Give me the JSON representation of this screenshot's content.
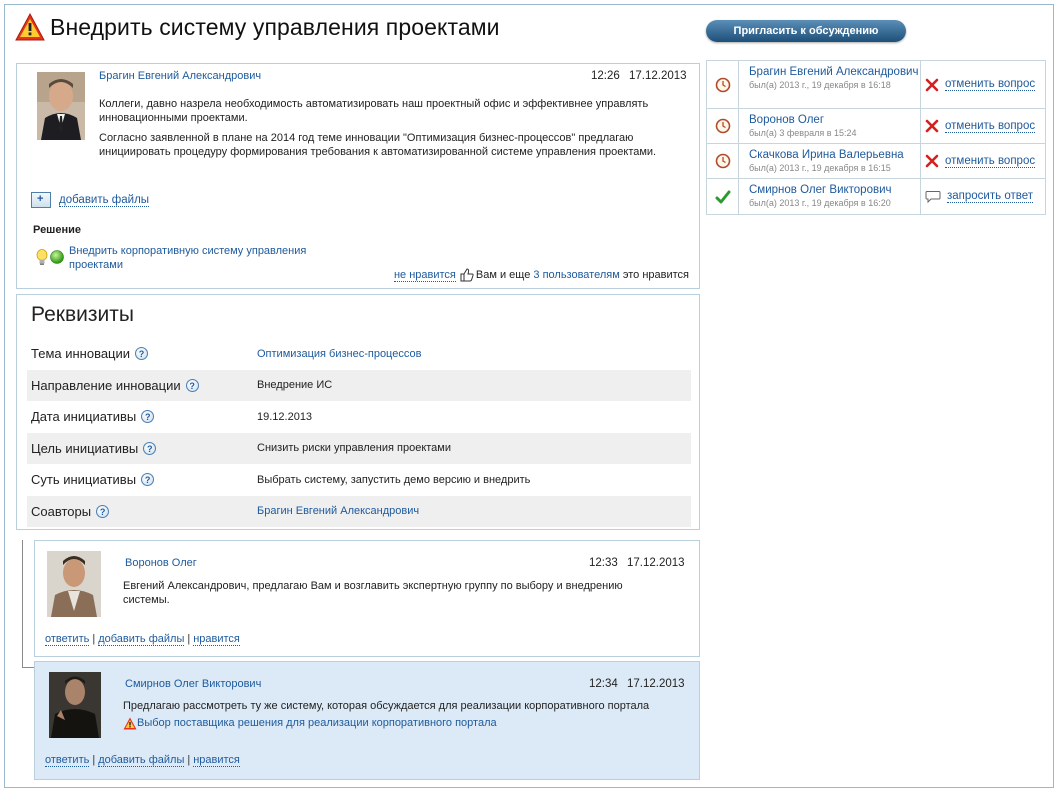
{
  "page": {
    "title": "Внедрить систему управления проектами",
    "invite_button": "Пригласить к обсуждению"
  },
  "post": {
    "author": "Брагин Евгений Александрович",
    "time": "12:26",
    "date": "17.12.2013",
    "paragraphs": [
      "Коллеги, давно назрела необходимость автоматизировать наш проектный офис и эффективнее управлять инновационными проектами.",
      "Согласно заявленной в плане на 2014 год теме инновации \"Оптимизация бизнес-процессов\" предлагаю инициировать процедуру формирования требования к автоматизированной системе управления проектами."
    ],
    "add_files": "добавить файлы",
    "solution_heading": "Решение",
    "solution_link": "Внедрить корпоративную систему управления проектами",
    "dislike": "не нравится",
    "likes_prefix": "Вам и еще",
    "likes_link": "3 пользователям",
    "likes_suffix": "это нравится"
  },
  "requisites": {
    "title": "Реквизиты",
    "rows": [
      {
        "label": "Тема инновации",
        "value": "Оптимизация бизнес-процессов",
        "is_link": true
      },
      {
        "label": "Направление инновации",
        "value": "Внедрение ИС",
        "is_link": false
      },
      {
        "label": "Дата инициативы",
        "value": "19.12.2013",
        "is_link": false
      },
      {
        "label": "Цель инициативы",
        "value": "Снизить риски управления проектами",
        "is_link": false
      },
      {
        "label": "Суть инициативы",
        "value": "Выбрать систему, запустить демо версию и внедрить",
        "is_link": false
      },
      {
        "label": "Соавторы",
        "value": "Брагин Евгений Александрович",
        "is_link": true
      }
    ],
    "help_glyph": "?"
  },
  "comments": [
    {
      "author": "Воронов Олег",
      "time": "12:33",
      "date": "17.12.2013",
      "text": "Евгений Александрович, предлагаю Вам и возглавить экспертную группу по выбору и внедрению системы.",
      "actions": [
        "ответить",
        "добавить файлы",
        "нравится"
      ]
    },
    {
      "author": "Смирнов Олег Викторович",
      "time": "12:34",
      "date": "17.12.2013",
      "text": "Предлагаю рассмотреть ту же систему, которая обсуждается для реализации корпоративного портала",
      "linked_item": "Выбор поставщика решения для реализации корпоративного портала",
      "actions": [
        "ответить",
        "добавить файлы",
        "нравится"
      ]
    }
  ],
  "participants": [
    {
      "name": "Брагин Евгений Александрович",
      "seen": "был(а) 2013 г., 19 декабря в 16:18",
      "status": "clock-icon",
      "action": "отменить вопрос",
      "action_icon": "red-x-icon"
    },
    {
      "name": "Воронов Олег",
      "seen": "был(а) 3 февраля в 15:24",
      "status": "clock-icon",
      "action": "отменить вопрос",
      "action_icon": "red-x-icon"
    },
    {
      "name": "Скачкова Ирина Валерьевна",
      "seen": "был(а) 2013 г., 19 декабря в 16:15",
      "status": "clock-icon",
      "action": "отменить вопрос",
      "action_icon": "red-x-icon"
    },
    {
      "name": "Смирнов Олег Викторович",
      "seen": "был(а) 2013 г., 19 декабря в 16:20",
      "status": "checkmark-icon",
      "action": "запросить ответ",
      "action_icon": "speech-bubble-icon"
    }
  ],
  "colors": {
    "link": "#1e5a9c",
    "button_gradient_top": "#5b8fb8",
    "button_gradient_bottom": "#1d4f79",
    "highlight_comment_bg": "#dceaf7",
    "row_alt_bg": "#efefef",
    "warning": "#e8321c",
    "cancel_x": "#d42020",
    "check": "#2e9a2e"
  }
}
